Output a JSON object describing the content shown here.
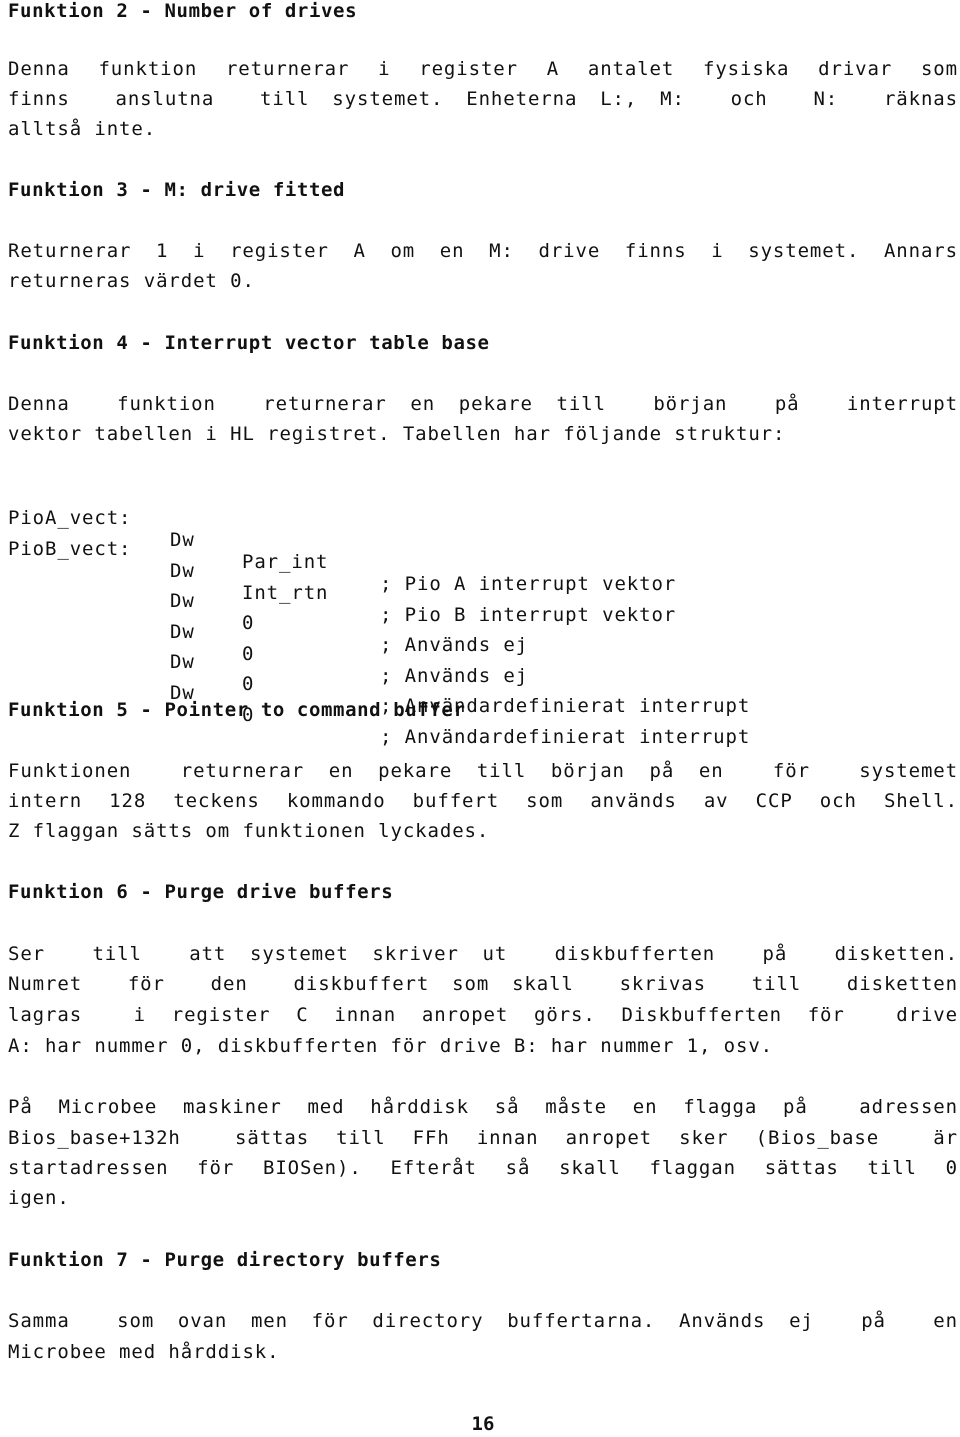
{
  "sections": [
    {
      "heading": "Funktion 2 - Number of drives",
      "paragraphs": [
        [
          "Denna funktion returnerar i register A antalet fysiska drivar som",
          "finns  anslutna  till systemet. Enheterna L:, M:  och  N:  räknas",
          "alltså inte."
        ]
      ]
    },
    {
      "heading": "Funktion 3 - M: drive fitted",
      "paragraphs": [
        [
          "Returnerar 1 i register A om en M: drive finns i systemet. Annars",
          "returneras värdet 0."
        ]
      ]
    },
    {
      "heading": "Funktion 4 - Interrupt vector table base",
      "paragraphs": [
        [
          "Denna  funktion  returnerar en pekare till  början  på  interrupt",
          "vektor tabellen i HL registret. Tabellen har följande struktur:"
        ]
      ],
      "code": [
        {
          "label": "PioA_vect:",
          "op": "Dw",
          "arg": "Par_int",
          "comment": "; Pio A interrupt vektor"
        },
        {
          "label": "PioB_vect:",
          "op": "Dw",
          "arg": "Int_rtn",
          "comment": "; Pio B interrupt vektor"
        },
        {
          "label": "",
          "op": "Dw",
          "arg": "0",
          "comment": "; Används ej"
        },
        {
          "label": "",
          "op": "Dw",
          "arg": "0",
          "comment": "; Används ej"
        },
        {
          "label": "",
          "op": "Dw",
          "arg": "0",
          "comment": "; Användardefinierat interrupt"
        },
        {
          "label": "",
          "op": "Dw",
          "arg": "0",
          "comment": "; Användardefinierat interrupt"
        }
      ]
    },
    {
      "heading": "Funktion 5 - Pointer to command buffer",
      "paragraphs": [
        [
          "Funktionen  returnerar en pekare till början på en  för  systemet",
          "intern 128 teckens kommando buffert som används av CCP och Shell.",
          "Z flaggan sätts om funktionen lyckades."
        ]
      ]
    },
    {
      "heading": "Funktion 6 - Purge drive buffers",
      "paragraphs": [
        [
          "Ser  till  att systemet skriver ut  diskbufferten  på  disketten.",
          "Numret  för  den  diskbuffert som skall  skrivas  till  disketten",
          "lagras  i register C innan anropet görs. Diskbufferten för  drive",
          "A: har nummer 0, diskbufferten för drive B: har nummer 1, osv."
        ],
        [
          "På Microbee maskiner med hårddisk så måste en flagga på  adressen",
          "Bios_base+132h  sättas till FFh innan anropet sker (Bios_base  är",
          "startadressen för BIOSen). Efteråt så skall flaggan sättas till 0",
          "igen."
        ]
      ]
    },
    {
      "heading": "Funktion 7 - Purge directory buffers",
      "paragraphs": [
        [
          "Samma  som ovan men för directory buffertarna. Används ej  på  en",
          "Microbee med hårddisk."
        ]
      ]
    }
  ],
  "page_number": "16"
}
